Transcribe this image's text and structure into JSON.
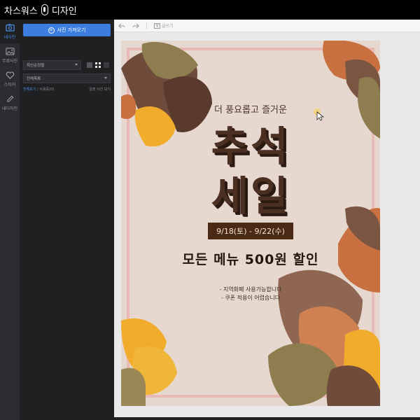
{
  "app": {
    "brand_left": "차스워스",
    "brand_right": "디자인"
  },
  "rail": [
    {
      "label": "내사진",
      "icon": "photo-icon",
      "active": true
    },
    {
      "label": "무료사진",
      "icon": "image-free-icon",
      "active": false
    },
    {
      "label": "스티커",
      "icon": "heart-icon",
      "active": false
    },
    {
      "label": "내디자인",
      "icon": "pencil-icon",
      "active": false
    }
  ],
  "panel": {
    "upload_label": "사진 가져오기",
    "sort_value": "최신순정렬",
    "category_value": "전체목록",
    "filter_all": "전체보기",
    "filter_sep": "/",
    "filter_used": "사용중(0)",
    "filter_unused": "일괄 사진 보기"
  },
  "toolbar": {
    "text_label": "글쓰기"
  },
  "poster": {
    "subtitle": "더 풍요롭고 즐거운",
    "title_line1": "추석",
    "title_line2": "세일",
    "date": "9/18(토) - 9/22(수)",
    "promo": "모든 메뉴 500원 할인",
    "note1": "- 지역화폐 사용가능합니다",
    "note2": "- 쿠폰 적용이 어렵습니다"
  },
  "colors": {
    "accent": "#3c7ee0",
    "poster_bg": "#e7d8cf",
    "frame": "#e8b9b5",
    "title": "#4b2f23",
    "date_bg": "#4a2a14",
    "leaf_brown": "#6e4b3a",
    "leaf_olive": "#8d7d4f",
    "leaf_yellow": "#f2ac2c",
    "leaf_orange": "#c8703f"
  }
}
